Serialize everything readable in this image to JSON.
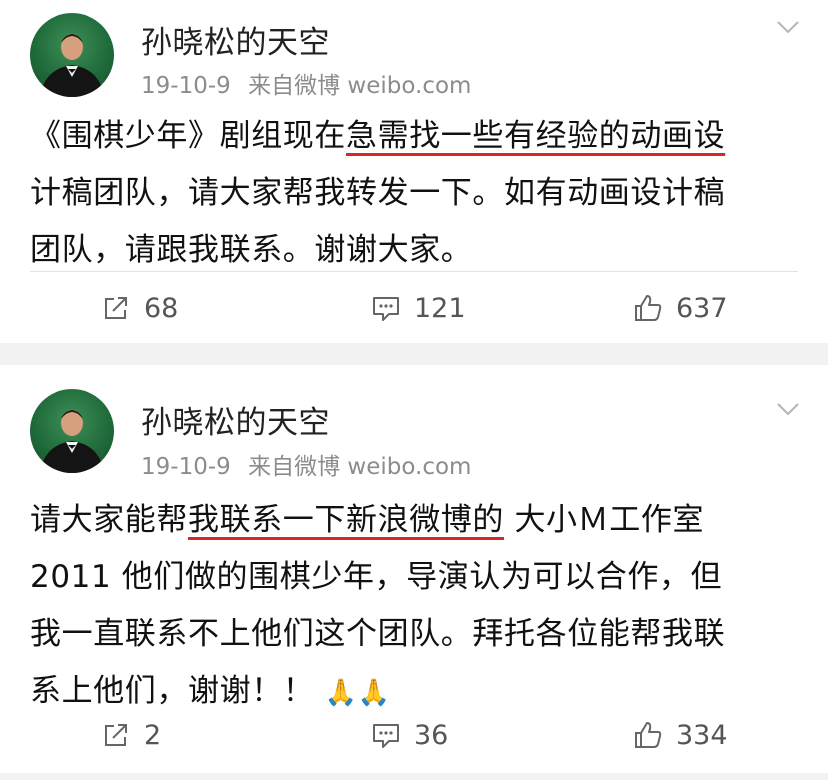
{
  "posts": [
    {
      "username": "孙晓松的天空",
      "date": "19-10-9",
      "source": "来自微博 weibo.com",
      "text_line1_pre": "《围棋少年》剧组现在",
      "text_line1_hl": "急需找一些有经验的动画设",
      "text_line2": "计稿团队，请大家帮我转发一下。如有动画设计稿",
      "text_line3": "团队，请跟我联系。谢谢大家。",
      "reposts": "68",
      "comments": "121",
      "likes": "637"
    },
    {
      "username": "孙晓松的天空",
      "date": "19-10-9",
      "source": "来自微博 weibo.com",
      "text_line1_pre": "请大家能帮",
      "text_line1_hl": "我联系一下新浪微博的",
      "text_line1_post": " 大小Ｍ工作室",
      "text_line2": "2011 他们做的围棋少年，导演认为可以合作，但",
      "text_line3": "我一直联系不上他们这个团队。拜托各位能帮我联",
      "text_line4": "系上他们，谢谢！！",
      "emoji": "🙏🙏",
      "reposts": "2",
      "comments": "36",
      "likes": "334"
    }
  ],
  "icons": {
    "repost": "repost-icon",
    "comment": "comment-icon",
    "like": "like-icon",
    "more": "chevron-down-icon"
  },
  "colors": {
    "underline": "#d8262b",
    "background": "#f2f2f2"
  }
}
